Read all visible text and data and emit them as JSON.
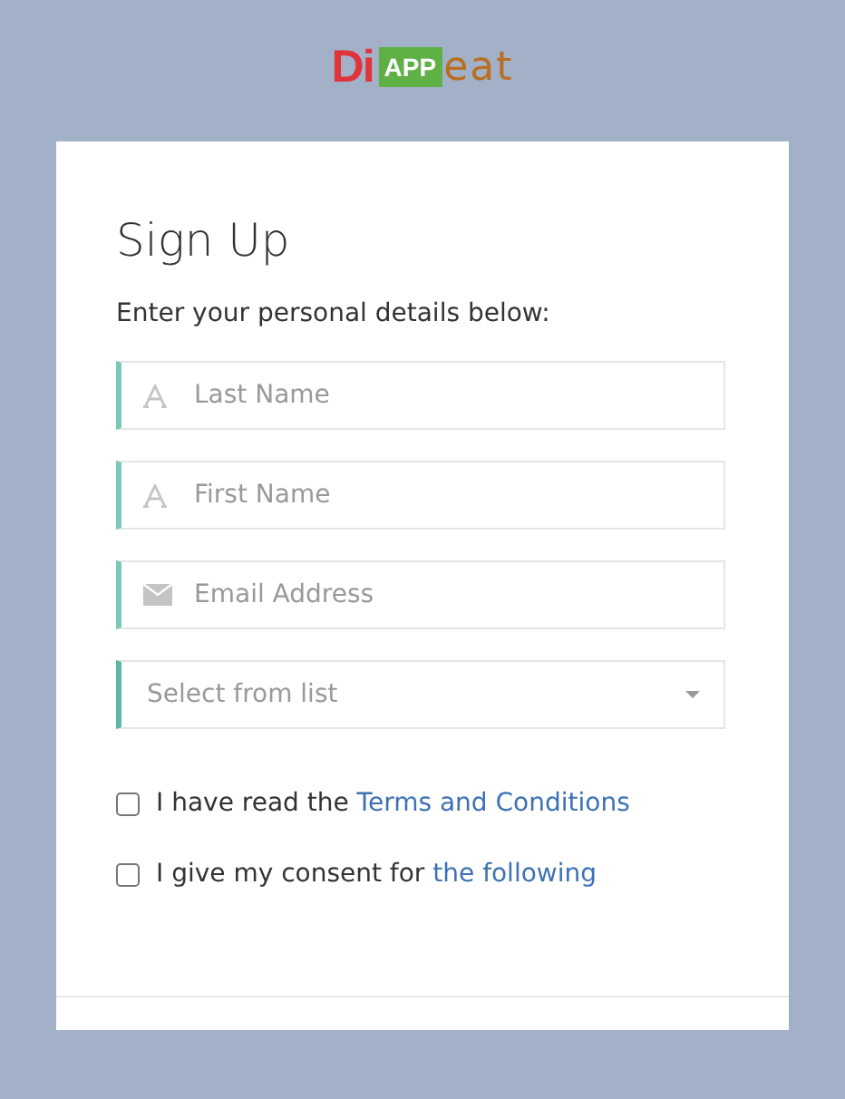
{
  "logo": {
    "part_1": "Di",
    "part_2": "APP",
    "part_3": "eat"
  },
  "form": {
    "title": "Sign Up",
    "subtitle": "Enter your personal details below:",
    "fields": [
      {
        "kind": "name",
        "placeholder": "Last Name"
      },
      {
        "kind": "name",
        "placeholder": "First Name"
      },
      {
        "kind": "email",
        "placeholder": "Email Address"
      },
      {
        "kind": "select",
        "placeholder": "Select from list"
      }
    ],
    "checkboxes": [
      {
        "text": "I have read the ",
        "link": "Terms and Conditions",
        "checked": false
      },
      {
        "text": "I give my consent for ",
        "link": "the following",
        "checked": false
      }
    ]
  }
}
